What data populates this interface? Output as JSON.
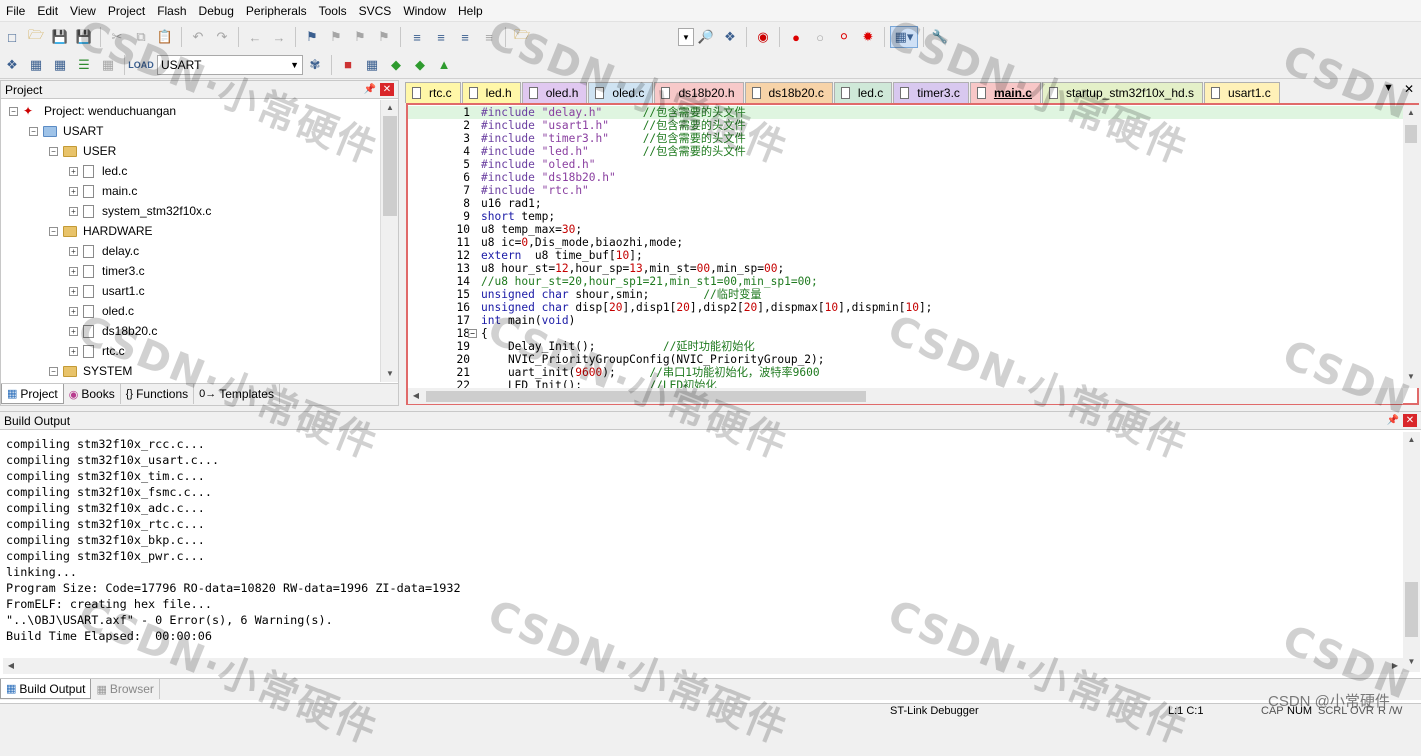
{
  "menu": [
    "File",
    "Edit",
    "View",
    "Project",
    "Flash",
    "Debug",
    "Peripherals",
    "Tools",
    "SVCS",
    "Window",
    "Help"
  ],
  "toolbar": {
    "target": "USART",
    "icons": [
      "new-file-icon",
      "open-file-icon",
      "save-icon",
      "save-all-icon",
      "cut-icon",
      "copy-icon",
      "paste-icon",
      "undo-icon",
      "redo-icon",
      "nav-back-icon",
      "nav-forward-icon",
      "bookmark-icon",
      "indent-icon",
      "find-icon",
      "debug-icon",
      "breakpoint-icon",
      "build-icon",
      "rebuild-icon",
      "download-icon",
      "options-icon"
    ]
  },
  "project_panel": {
    "title": "Project",
    "tree": [
      {
        "label": "Project: wenduchuangan",
        "level": 0,
        "kind": "project"
      },
      {
        "label": "USART",
        "level": 1,
        "kind": "target"
      },
      {
        "label": "USER",
        "level": 2,
        "kind": "folder"
      },
      {
        "label": "led.c",
        "level": 3,
        "kind": "file"
      },
      {
        "label": "main.c",
        "level": 3,
        "kind": "file"
      },
      {
        "label": "system_stm32f10x.c",
        "level": 3,
        "kind": "file"
      },
      {
        "label": "HARDWARE",
        "level": 2,
        "kind": "folder"
      },
      {
        "label": "delay.c",
        "level": 3,
        "kind": "file"
      },
      {
        "label": "timer3.c",
        "level": 3,
        "kind": "file"
      },
      {
        "label": "usart1.c",
        "level": 3,
        "kind": "file"
      },
      {
        "label": "oled.c",
        "level": 3,
        "kind": "file"
      },
      {
        "label": "ds18b20.c",
        "level": 3,
        "kind": "file"
      },
      {
        "label": "rtc.c",
        "level": 3,
        "kind": "file"
      },
      {
        "label": "SYSTEM",
        "level": 2,
        "kind": "folder"
      }
    ],
    "tabs": [
      "Project",
      "Books",
      "Functions",
      "Templates"
    ]
  },
  "editor": {
    "tabs": [
      {
        "label": "rtc.c",
        "color": "#fff7a8"
      },
      {
        "label": "led.h",
        "color": "#fff7a8"
      },
      {
        "label": "oled.h",
        "color": "#e0c8f0"
      },
      {
        "label": "oled.c",
        "color": "#cfe3f2"
      },
      {
        "label": "ds18b20.h",
        "color": "#f7c9c9"
      },
      {
        "label": "ds18b20.c",
        "color": "#f7d3a8"
      },
      {
        "label": "led.c",
        "color": "#cfe8d8"
      },
      {
        "label": "timer3.c",
        "color": "#d8c8ef"
      },
      {
        "label": "main.c",
        "color": "#f8c7c7"
      },
      {
        "label": "startup_stm32f10x_hd.s",
        "color": "#e4f0c8"
      },
      {
        "label": "usart1.c",
        "color": "#fff1b8"
      }
    ],
    "active_tab": "main.c",
    "lines": [
      {
        "n": "1",
        "t": "#include \"delay.h\"      //包含需要的头文件"
      },
      {
        "n": "2",
        "t": "#include \"usart1.h\"     //包含需要的头文件"
      },
      {
        "n": "3",
        "t": "#include \"timer3.h\"     //包含需要的头文件"
      },
      {
        "n": "4",
        "t": "#include \"led.h\"        //包含需要的头文件"
      },
      {
        "n": "5",
        "t": "#include \"oled.h\""
      },
      {
        "n": "6",
        "t": "#include \"ds18b20.h\""
      },
      {
        "n": "7",
        "t": "#include \"rtc.h\""
      },
      {
        "n": "8",
        "t": "u16 rad1;"
      },
      {
        "n": "9",
        "t": "short temp;"
      },
      {
        "n": "10",
        "t": "u8 temp_max=30;"
      },
      {
        "n": "11",
        "t": "u8 ic=0,Dis_mode,biaozhi,mode;"
      },
      {
        "n": "12",
        "t": "extern  u8 time_buf[10];"
      },
      {
        "n": "13",
        "t": "u8 hour_st=12,hour_sp=13,min_st=00,min_sp=00;"
      },
      {
        "n": "14",
        "t": "//u8 hour_st=20,hour_sp1=21,min_st1=00,min_sp1=00;"
      },
      {
        "n": "15",
        "t": "unsigned char shour,smin;        //临时变量"
      },
      {
        "n": "16",
        "t": "unsigned char disp[20],disp1[20],disp2[20],dispmax[10],dispmin[10];"
      },
      {
        "n": "17",
        "t": "int main(void)"
      },
      {
        "n": "18",
        "t": "{"
      },
      {
        "n": "19",
        "t": "    Delay_Init();          //延时功能初始化"
      },
      {
        "n": "20",
        "t": "    NVIC_PriorityGroupConfig(NVIC_PriorityGroup_2);"
      },
      {
        "n": "21",
        "t": "    uart_init(9600);     //串口1功能初始化，波特率9600"
      },
      {
        "n": "22",
        "t": "    LED_Init();          //LED初始化"
      }
    ]
  },
  "build_output": {
    "title": "Build Output",
    "lines": [
      "compiling stm32f10x_rcc.c...",
      "compiling stm32f10x_usart.c...",
      "compiling stm32f10x_tim.c...",
      "compiling stm32f10x_fsmc.c...",
      "compiling stm32f10x_adc.c...",
      "compiling stm32f10x_rtc.c...",
      "compiling stm32f10x_bkp.c...",
      "compiling stm32f10x_pwr.c...",
      "linking...",
      "Program Size: Code=17796 RO-data=10820 RW-data=1996 ZI-data=1932",
      "FromELF: creating hex file...",
      "\"..\\OBJ\\USART.axf\" - 0 Error(s), 6 Warning(s).",
      "Build Time Elapsed:  00:00:06"
    ],
    "tabs": [
      "Build Output",
      "Browser"
    ]
  },
  "status": {
    "debugger": "ST-Link Debugger",
    "position": "L:1 C:1",
    "indicators": [
      "CAP",
      "NUM",
      "SCRL",
      "OVR",
      "R /W"
    ]
  },
  "watermark": {
    "brand": "CSDN",
    "author": "·小常硬件",
    "credit": "CSDN @小常硬件"
  }
}
